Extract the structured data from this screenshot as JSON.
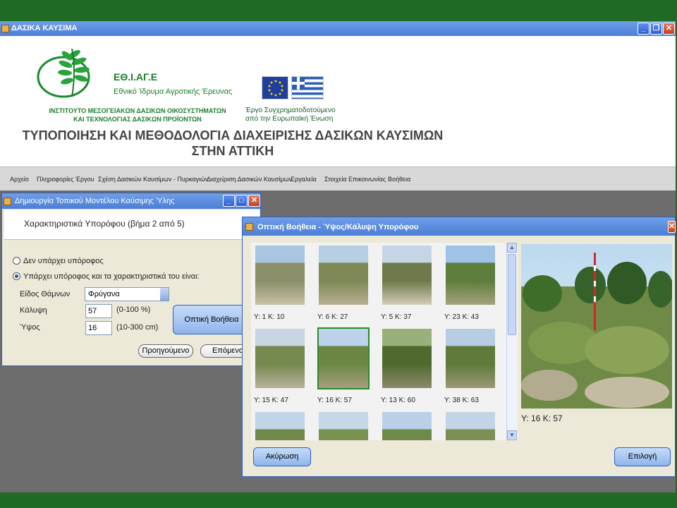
{
  "app": {
    "title": "ΔΑΣΙΚΑ ΚΑΥΣΙΜΑ"
  },
  "header": {
    "org_abbr": "ΕΘ.Ι.ΑΓ.Ε",
    "org_full": "Εθνικό Ίδρυμα Αγροτικής Έρευνας",
    "institute_line1": "ΙΝΣΤΙΤΟΥΤΟ ΜΕΣΟΓΕΙΑΚΩΝ ΔΑΣΙΚΩΝ ΟΙΚΟΣΥΣΤΗΜΑΤΩΝ",
    "institute_line2": "ΚΑΙ ΤΕΧΝΟΛΟΓΙΑΣ ΔΑΣΙΚΩΝ ΠΡΟΪΟΝΤΩΝ",
    "cofund_line1": "Έργο Συγχρηματοδοτούμενο",
    "cofund_line2": "από την Ευρωπαϊκή Ένωση",
    "project_line1": "ΤΥΠΟΠΟΙΗΣΗ ΚΑΙ ΜΕΘΟΔΟΛΟΓΙΑ ΔΙΑΧΕΙΡΙΣΗΣ ΔΑΣΙΚΩΝ ΚΑΥΣΙΜΩΝ",
    "project_line2": "ΣΤΗΝ ΑΤΤΙΚΗ"
  },
  "menu": [
    "Αρχείο",
    "Πληροφορίες Έργου",
    "Σχέση Δασικών Καυσίμων - Πυρκαγιών",
    "Διαχείριση Δασικών Καυσίμων",
    "Εργαλεία",
    "Στοιχεία Επικοινωνίας",
    "Βοήθεια"
  ],
  "model_dialog": {
    "title": "Δημιουργία Τοπικού Μοντέλου Καύσιμης Ύλης",
    "step": "Χαρακτηριστικά Υπορόφου (βήμα 2 από 5)",
    "radio_none": "Δεν υπάρχει υπόροφος",
    "radio_exists": "Υπάρχει υπόροφος και τα χαρακτηριστικά του είναι:",
    "species_label": "Είδος Θάμνων",
    "species_value": "Φρύγανα",
    "cover_label": "Κάλυψη",
    "cover_value": "57",
    "cover_range": "(0-100 %)",
    "height_label": "Ύψος",
    "height_value": "16",
    "height_range": "(10-300 cm)",
    "visual_help_button": "Οπτική Βοήθεια",
    "prev_button": "Προηγούμενο",
    "next_button": "Επόμενο"
  },
  "visual_dialog": {
    "title": "Οπτική Βοήθεια - Ύψος/Κάλυψη Υπορόφου",
    "thumbnails": [
      "Y: 1 K: 10",
      "Y: 6 K: 27",
      "Y: 5 K: 37",
      "Y: 23 K: 43",
      "Y: 15 K: 47",
      "Y: 16 K: 57",
      "Y: 13 K: 60",
      "Y: 38 K: 63",
      "",
      "",
      "",
      ""
    ],
    "selected_caption": "Y: 16 K: 57",
    "cancel_button": "Ακύρωση",
    "select_button": "Επιλογή"
  },
  "colors": {
    "frame_green": "#1f6a24",
    "titlebar_blue": "#4b7fd6",
    "selection_green": "#2a8a2a"
  }
}
